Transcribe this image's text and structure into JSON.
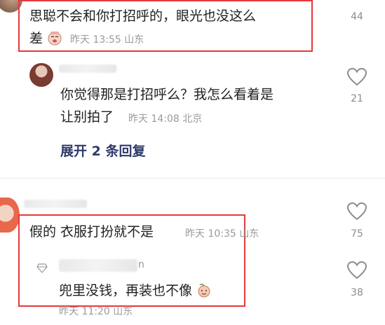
{
  "comments": [
    {
      "text_line1": "思聪不会和你打招呼的，眼光也没这么",
      "text_line2": "差",
      "time": "昨天 13:55",
      "location": "山东",
      "like_count": "44",
      "emoji": "crying-face-sticker"
    },
    {
      "text_line1": "你觉得那是打招呼么？我怎么看着是",
      "text_line2": "让别拍了",
      "time": "昨天 14:08",
      "location": "北京",
      "like_count": "21"
    },
    {
      "expand_label": "展开 2 条回复"
    },
    {
      "text": "假的 衣服打扮就不是",
      "time": "昨天 10:35",
      "location": "山东",
      "like_count": "75"
    },
    {
      "name_suffix": "n",
      "text": "兜里没钱，再装也不像",
      "time": "昨天 11:20",
      "location": "山东",
      "like_count": "38",
      "emoji": "peach-face-sticker",
      "badge_icon": "diamond-icon"
    }
  ],
  "colors": {
    "highlight": "#e5383b",
    "expand": "#2d3a6b",
    "meta": "#9a9a9a"
  }
}
